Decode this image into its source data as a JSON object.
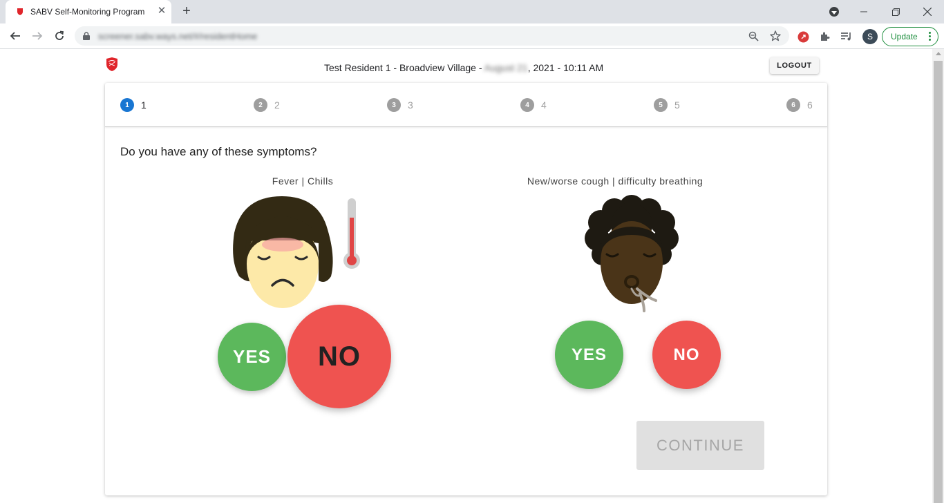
{
  "browser": {
    "tab_title": "SABV Self-Monitoring Program",
    "url": "screener.sabv.ways.net/#/residentHome",
    "update_label": "Update",
    "profile_initial": "S",
    "accent_color": "#1e8e3e"
  },
  "header": {
    "resident_info_prefix": "Test Resident 1 - Broadview Village - ",
    "date_blurred": "August 21",
    "date_suffix": ", 2021 - 10:11 AM",
    "logout_label": "LOGOUT"
  },
  "stepper": {
    "steps": [
      {
        "number": "1",
        "label": "1",
        "active": true
      },
      {
        "number": "2",
        "label": "2",
        "active": false
      },
      {
        "number": "3",
        "label": "3",
        "active": false
      },
      {
        "number": "4",
        "label": "4",
        "active": false
      },
      {
        "number": "5",
        "label": "5",
        "active": false
      },
      {
        "number": "6",
        "label": "6",
        "active": false
      }
    ],
    "active_color": "#1976d2"
  },
  "main": {
    "question": "Do you have any of these symptoms?",
    "symptoms": [
      {
        "label": "Fever | Chills",
        "yes_label": "YES",
        "no_label": "NO"
      },
      {
        "label": "New/worse cough | difficulty breathing",
        "yes_label": "YES",
        "no_label": "NO"
      }
    ],
    "continue_label": "CONTINUE",
    "colors": {
      "yes": "#5cb85c",
      "no": "#ef5350"
    }
  }
}
